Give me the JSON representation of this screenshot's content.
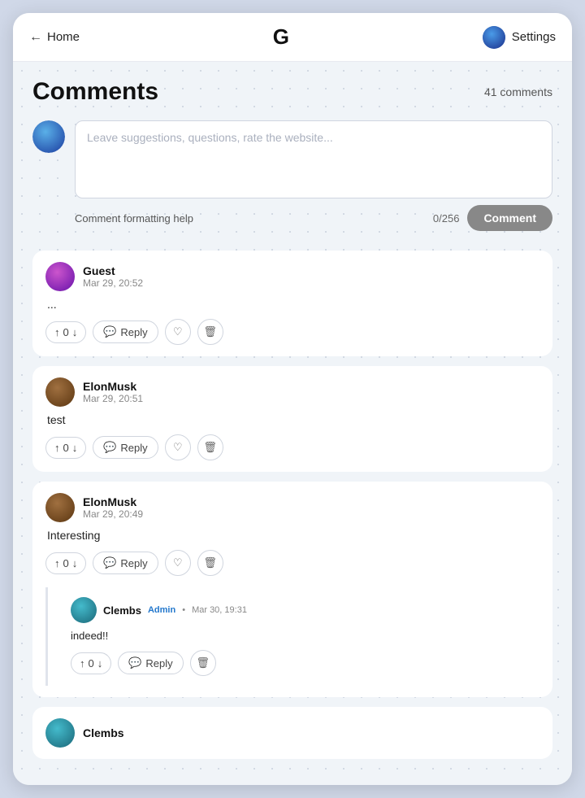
{
  "header": {
    "back_label": "Home",
    "logo": "G",
    "settings_label": "Settings"
  },
  "page": {
    "title": "Comments",
    "comment_count": "41 comments"
  },
  "input": {
    "placeholder": "Leave suggestions, questions, rate the website...",
    "char_count": "0/256",
    "format_help": "Comment formatting help",
    "submit_label": "Comment"
  },
  "comments": [
    {
      "id": 1,
      "author": "Guest",
      "date": "Mar 29, 20:52",
      "text": "...",
      "vote_count": "0",
      "avatar_type": "purple",
      "replies": []
    },
    {
      "id": 2,
      "author": "ElonMusk",
      "date": "Mar 29, 20:51",
      "text": "test",
      "vote_count": "0",
      "avatar_type": "brown",
      "replies": []
    },
    {
      "id": 3,
      "author": "ElonMusk",
      "date": "Mar 29, 20:49",
      "text": "Interesting",
      "vote_count": "0",
      "avatar_type": "brown",
      "replies": [
        {
          "id": 31,
          "author": "Clembs",
          "date": "Mar 30, 19:31",
          "admin_badge": "Admin",
          "text": "indeed!!",
          "vote_count": "0",
          "avatar_type": "teal"
        }
      ]
    }
  ],
  "partial_comment": {
    "author": "Clembs",
    "avatar_type": "teal"
  },
  "buttons": {
    "reply": "Reply"
  }
}
